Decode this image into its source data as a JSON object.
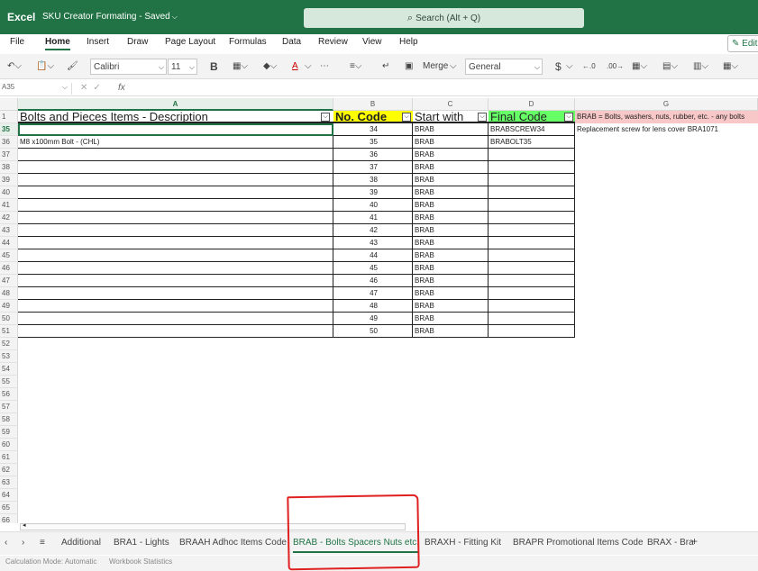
{
  "titlebar": {
    "app": "Excel",
    "doc": "SKU Creator Formating - Saved",
    "search_placeholder": "Search (Alt + Q)"
  },
  "menu": [
    "File",
    "Home",
    "Insert",
    "Draw",
    "Page Layout",
    "Formulas",
    "Data",
    "Review",
    "View",
    "Help"
  ],
  "edit_label": "Edit",
  "ribbon": {
    "font": "Calibri",
    "size": "11",
    "bold": "B",
    "merge": "Merge",
    "number_format": "General",
    "currency": "$"
  },
  "namebox": "A35",
  "fx": "fx",
  "columns": [
    "A",
    "B",
    "C",
    "D",
    "G"
  ],
  "header_row": {
    "num": "1",
    "a": "Bolts and Pieces Items - Description",
    "b": "No. Code",
    "c": "Start with",
    "d": "Final Code",
    "g": "BRAB = Bolts, washers, nuts, rubber, etc. - any bolts"
  },
  "rows": [
    {
      "n": "35",
      "a": "",
      "b": "34",
      "c": "BRAB",
      "d": "BRABSCREW34",
      "g": "Replacement screw for lens cover BRA1071"
    },
    {
      "n": "36",
      "a": "M8 x100mm Bolt - (CHL)",
      "b": "35",
      "c": "BRAB",
      "d": "BRABOLT35",
      "g": ""
    },
    {
      "n": "37",
      "a": "",
      "b": "36",
      "c": "BRAB",
      "d": "",
      "g": ""
    },
    {
      "n": "38",
      "a": "",
      "b": "37",
      "c": "BRAB",
      "d": "",
      "g": ""
    },
    {
      "n": "39",
      "a": "",
      "b": "38",
      "c": "BRAB",
      "d": "",
      "g": ""
    },
    {
      "n": "40",
      "a": "",
      "b": "39",
      "c": "BRAB",
      "d": "",
      "g": ""
    },
    {
      "n": "41",
      "a": "",
      "b": "40",
      "c": "BRAB",
      "d": "",
      "g": ""
    },
    {
      "n": "42",
      "a": "",
      "b": "41",
      "c": "BRAB",
      "d": "",
      "g": ""
    },
    {
      "n": "43",
      "a": "",
      "b": "42",
      "c": "BRAB",
      "d": "",
      "g": ""
    },
    {
      "n": "44",
      "a": "",
      "b": "43",
      "c": "BRAB",
      "d": "",
      "g": ""
    },
    {
      "n": "45",
      "a": "",
      "b": "44",
      "c": "BRAB",
      "d": "",
      "g": ""
    },
    {
      "n": "46",
      "a": "",
      "b": "45",
      "c": "BRAB",
      "d": "",
      "g": ""
    },
    {
      "n": "47",
      "a": "",
      "b": "46",
      "c": "BRAB",
      "d": "",
      "g": ""
    },
    {
      "n": "48",
      "a": "",
      "b": "47",
      "c": "BRAB",
      "d": "",
      "g": ""
    },
    {
      "n": "49",
      "a": "",
      "b": "48",
      "c": "BRAB",
      "d": "",
      "g": ""
    },
    {
      "n": "50",
      "a": "",
      "b": "49",
      "c": "BRAB",
      "d": "",
      "g": ""
    },
    {
      "n": "51",
      "a": "",
      "b": "50",
      "c": "BRAB",
      "d": "",
      "g": ""
    }
  ],
  "empty_rows": [
    "52",
    "53",
    "54",
    "55",
    "56",
    "57",
    "58",
    "59",
    "60",
    "61",
    "62",
    "63",
    "64",
    "65",
    "66"
  ],
  "tabs": [
    "Additional",
    "BRA1 - Lights",
    "BRAAH Adhoc Items Code",
    "BRAB - Bolts Spacers Nuts etc.",
    "BRAXH - Fitting Kit",
    "BRAPR Promotional Items Code",
    "BRAX - Bra"
  ],
  "active_tab": "BRAB - Bolts Spacers Nuts etc.",
  "status": {
    "calc": "Calculation Mode: Automatic",
    "stats": "Workbook Statistics"
  },
  "colors": {
    "brand": "#217346",
    "yellow": "#ffff00",
    "green": "#66ff66",
    "pink": "#f8c8c8",
    "annotation": "#e02020"
  }
}
